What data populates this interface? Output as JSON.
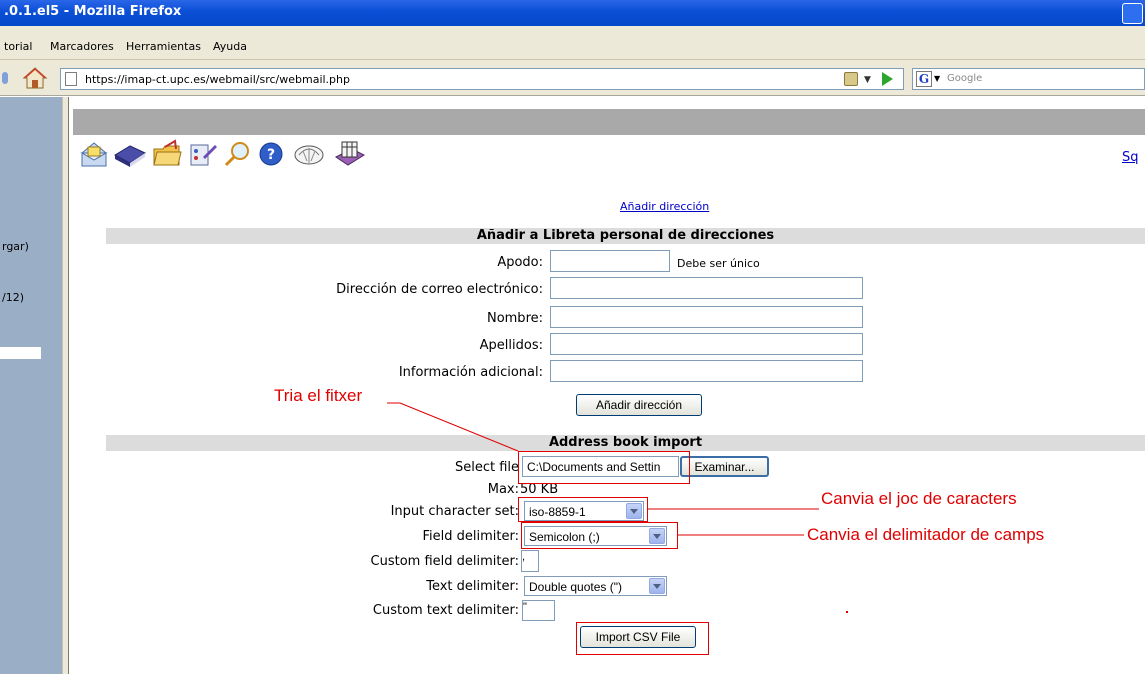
{
  "window": {
    "title": ".0.1.el5 - Mozilla Firefox"
  },
  "menu": [
    "torial",
    "Marcadores",
    "Herramientas",
    "Ayuda"
  ],
  "nav": {
    "url": "https://imap-ct.upc.es/webmail/src/webmail.php",
    "search_placeholder": "Google"
  },
  "left_frame": {
    "items": [
      "rgar)",
      "/12)"
    ]
  },
  "toolbar": {
    "icons": [
      "compose-icon",
      "addressbook-icon",
      "folders-icon",
      "options-icon",
      "search-icon",
      "help-icon",
      "shell-icon",
      "calendar-icon"
    ],
    "right_link": "Sq"
  },
  "add_link": "Añadir dirección",
  "addr_section": {
    "title": "Añadir a Libreta personal de direcciones",
    "fields": [
      {
        "label": "Apodo:",
        "value": ""
      },
      {
        "label": "Dirección de correo electrónico:",
        "value": ""
      },
      {
        "label": "Nombre:",
        "value": ""
      },
      {
        "label": "Apellidos:",
        "value": ""
      },
      {
        "label": "Información adicional:",
        "value": ""
      }
    ],
    "apodo_note": "Debe ser único",
    "add_button": "Añadir dirección"
  },
  "import_section": {
    "title": "Address book import",
    "select_file_label": "Select file",
    "file_value": "C:\\Documents and Settin",
    "browse_button": "Examinar...",
    "max_label": "Max:",
    "max_value": "50 KB",
    "charset_label": "Input character set:",
    "charset_value": "iso-8859-1",
    "field_delim_label": "Field delimiter:",
    "field_delim_value": "Semicolon (;)",
    "custom_field_label": "Custom field delimiter:",
    "custom_field_value": ",",
    "text_delim_label": "Text delimiter:",
    "text_delim_value": "Double quotes (\")",
    "custom_text_label": "Custom text delimiter:",
    "custom_text_value": "\"",
    "import_button": "Import CSV File"
  },
  "annotations": {
    "file": "Tria el fitxer",
    "charset": "Canvia el joc de caracters",
    "delimiter": "Canvia el delimitador de camps"
  },
  "colors": {
    "annotation": "#e00000",
    "link": "#0000cc",
    "section_bg": "#dcdcdc",
    "titlebar": "#0a4fd6",
    "left_frame": "#9aafc6"
  }
}
